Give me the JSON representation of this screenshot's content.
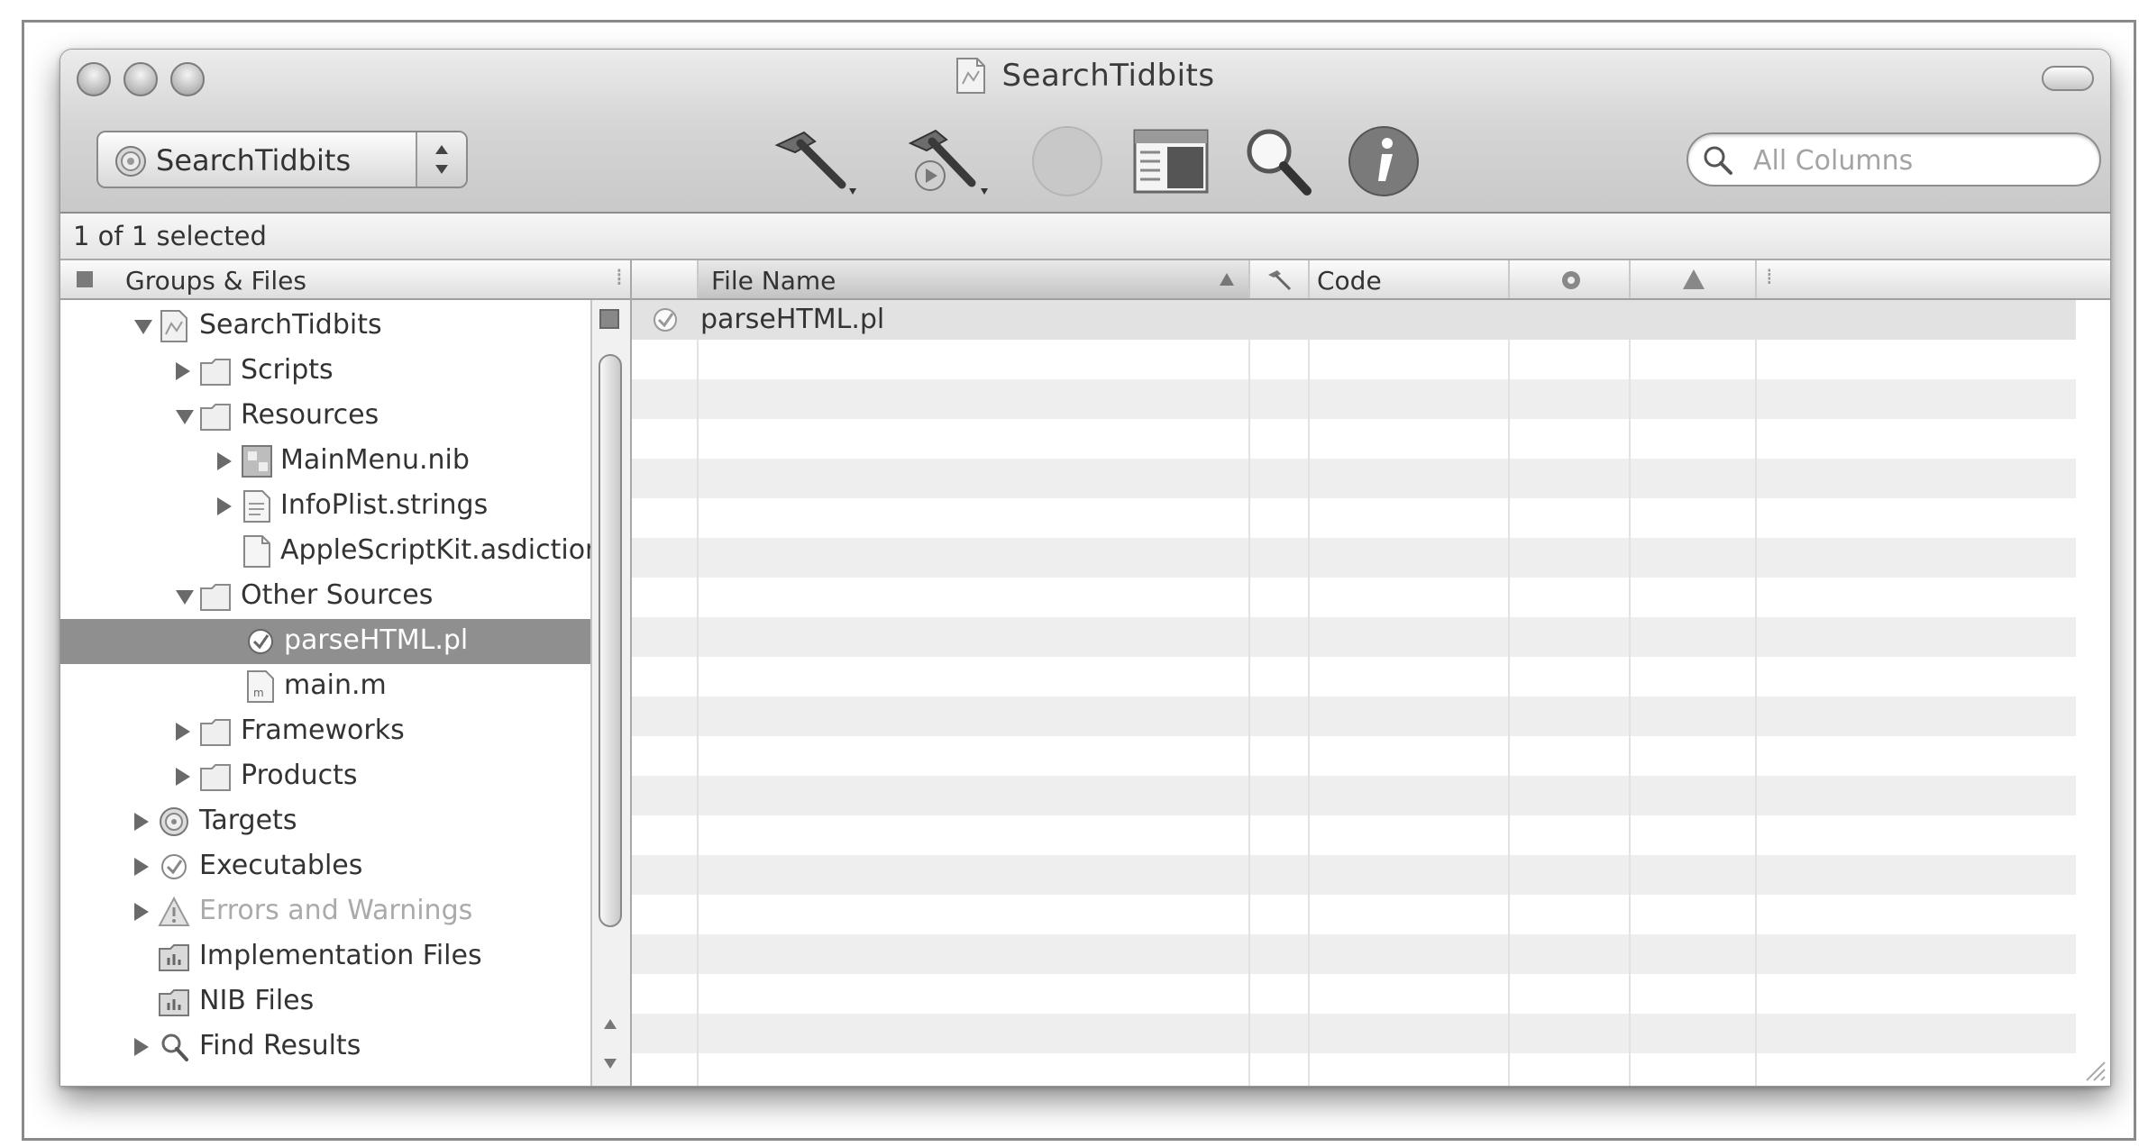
{
  "window": {
    "title": "SearchTidbits"
  },
  "toolbar": {
    "target_popup": "SearchTidbits",
    "search_placeholder": "All Columns",
    "tools": [
      "build-icon",
      "build-and-go-icon",
      "stop-icon",
      "editor-icon",
      "search-icon",
      "info-icon"
    ]
  },
  "status": {
    "selection": "1 of 1 selected"
  },
  "sidebar": {
    "header": "Groups & Files",
    "items": [
      {
        "label": "SearchTidbits",
        "icon": "project-icon",
        "expanded": true
      },
      {
        "label": "Scripts",
        "icon": "folder-icon",
        "expanded": false
      },
      {
        "label": "Resources",
        "icon": "folder-icon",
        "expanded": true
      },
      {
        "label": "MainMenu.nib",
        "icon": "nib-icon",
        "expanded": false
      },
      {
        "label": "InfoPlist.strings",
        "icon": "strings-file-icon",
        "expanded": false
      },
      {
        "label": "AppleScriptKit.asdictionary",
        "icon": "file-icon"
      },
      {
        "label": "Other Sources",
        "icon": "folder-icon",
        "expanded": true
      },
      {
        "label": "parseHTML.pl",
        "icon": "script-file-icon",
        "selected": true
      },
      {
        "label": "main.m",
        "icon": "source-file-icon"
      },
      {
        "label": "Frameworks",
        "icon": "folder-icon",
        "expanded": false
      },
      {
        "label": "Products",
        "icon": "folder-icon",
        "expanded": false
      },
      {
        "label": "Targets",
        "icon": "target-icon",
        "expanded": false
      },
      {
        "label": "Executables",
        "icon": "executable-icon",
        "expanded": false
      },
      {
        "label": "Errors and Warnings",
        "icon": "warning-icon",
        "expanded": false,
        "disabled": true
      },
      {
        "label": "Implementation Files",
        "icon": "smart-group-icon"
      },
      {
        "label": "NIB Files",
        "icon": "smart-group-icon"
      },
      {
        "label": "Find Results",
        "icon": "find-icon",
        "expanded": false
      }
    ]
  },
  "table": {
    "columns": {
      "file_name": "File Name",
      "code": "Code"
    },
    "rows": [
      {
        "file_name": "parseHTML.pl"
      }
    ]
  },
  "colors": {
    "selection": "#8f8f8f",
    "stripe": "#eeeeee",
    "chrome": "#d6d6d6"
  }
}
